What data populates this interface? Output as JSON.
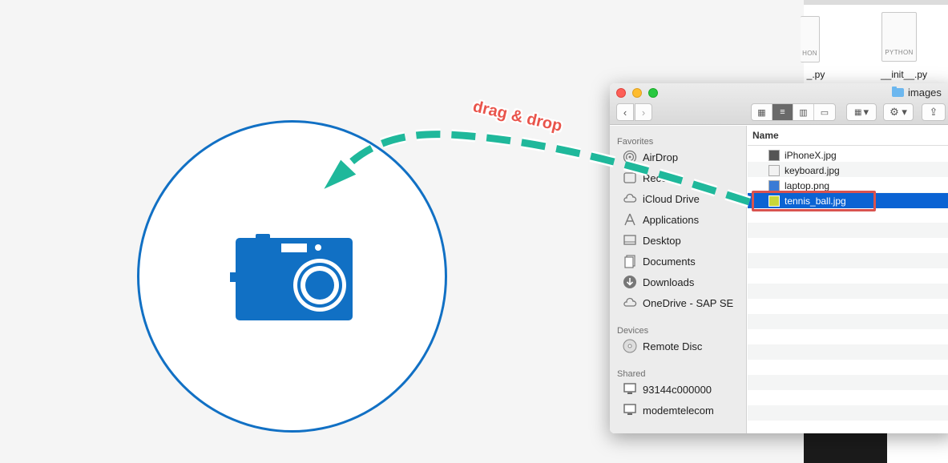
{
  "drop_area": {
    "icon": "camera-icon",
    "accent": "#1170c4"
  },
  "annotation": {
    "label": "drag & drop",
    "color": "#e9544b",
    "arrow_color": "#1fb89b"
  },
  "background_window": {
    "files": [
      {
        "name": "_.py",
        "tag": "HON"
      },
      {
        "name": "__init__.py",
        "tag": "PYTHON"
      }
    ]
  },
  "finder": {
    "title": "images",
    "nav": {
      "back": "‹",
      "forward": "›"
    },
    "toolbar": {
      "arrange": "▾",
      "action": "⚙ ▾",
      "share": "⇪"
    },
    "sidebar": {
      "favorites_label": "Favorites",
      "favorites": [
        {
          "label": "AirDrop",
          "icon": "airdrop-icon"
        },
        {
          "label": "Recents",
          "icon": "recents-icon"
        },
        {
          "label": "iCloud Drive",
          "icon": "cloud-icon"
        },
        {
          "label": "Applications",
          "icon": "applications-icon"
        },
        {
          "label": "Desktop",
          "icon": "desktop-icon"
        },
        {
          "label": "Documents",
          "icon": "documents-icon"
        },
        {
          "label": "Downloads",
          "icon": "downloads-icon"
        },
        {
          "label": "OneDrive - SAP SE",
          "icon": "cloud-icon"
        }
      ],
      "devices_label": "Devices",
      "devices": [
        {
          "label": "Remote Disc",
          "icon": "disc-icon"
        }
      ],
      "shared_label": "Shared",
      "shared": [
        {
          "label": "93144c000000",
          "icon": "monitor-icon"
        },
        {
          "label": "modemtelecom",
          "icon": "monitor-icon"
        }
      ]
    },
    "column_name": "Name",
    "files": [
      {
        "name": "iPhoneX.jpg",
        "selected": false
      },
      {
        "name": "keyboard.jpg",
        "selected": false
      },
      {
        "name": "laptop.png",
        "selected": false
      },
      {
        "name": "tennis_ball.jpg",
        "selected": true
      }
    ],
    "selection_color": "#0b63d3"
  }
}
